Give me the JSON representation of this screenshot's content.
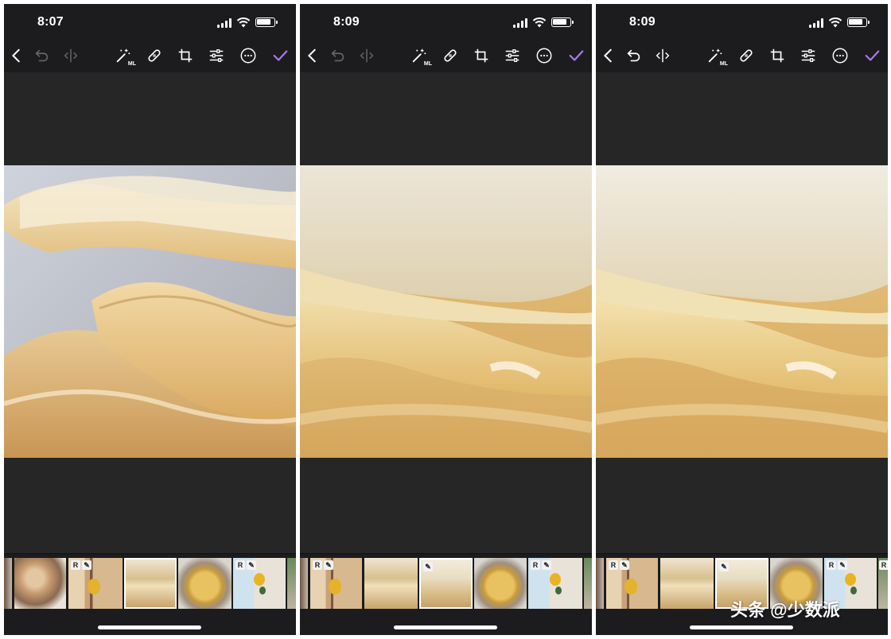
{
  "screens": [
    {
      "time": "8:07",
      "thumbs": [
        {
          "style": "t-dark",
          "badges": []
        },
        {
          "style": "t-meat",
          "badges": []
        },
        {
          "style": "t-room",
          "badges": [
            "R",
            "✎"
          ]
        },
        {
          "style": "t-yuba",
          "badges": [],
          "selected": true
        },
        {
          "style": "t-soup",
          "badges": []
        },
        {
          "style": "t-flower",
          "badges": [
            "R",
            "✎"
          ]
        },
        {
          "style": "t-green",
          "badges": []
        }
      ],
      "undo_enabled": false
    },
    {
      "time": "8:09",
      "thumbs": [
        {
          "style": "t-dark",
          "badges": []
        },
        {
          "style": "t-room",
          "badges": [
            "R",
            "✎"
          ]
        },
        {
          "style": "t-yuba",
          "badges": []
        },
        {
          "style": "t-yuba2",
          "badges": [
            "✎"
          ],
          "selected": true
        },
        {
          "style": "t-soup",
          "badges": []
        },
        {
          "style": "t-flower",
          "badges": [
            "R",
            "✎"
          ]
        },
        {
          "style": "t-green",
          "badges": []
        }
      ],
      "undo_enabled": false
    },
    {
      "time": "8:09",
      "thumbs": [
        {
          "style": "t-dark",
          "badges": []
        },
        {
          "style": "t-room",
          "badges": [
            "R",
            "✎"
          ]
        },
        {
          "style": "t-yuba",
          "badges": []
        },
        {
          "style": "t-yuba2",
          "badges": [
            "✎"
          ],
          "selected": true
        },
        {
          "style": "t-soup",
          "badges": []
        },
        {
          "style": "t-flower",
          "badges": [
            "R",
            "✎"
          ]
        },
        {
          "style": "t-green",
          "badges": [
            "R"
          ]
        }
      ],
      "undo_enabled": true
    }
  ],
  "toolbar": {
    "ml_label": "ML",
    "icons": [
      "back-icon",
      "undo-icon",
      "compare-icon",
      "ml-magic-wand-icon",
      "heal-bandage-icon",
      "crop-icon",
      "adjust-sliders-icon",
      "more-icon",
      "done-check-icon"
    ],
    "accent_color": "#a77be8"
  },
  "watermark": "头条 @少数派"
}
